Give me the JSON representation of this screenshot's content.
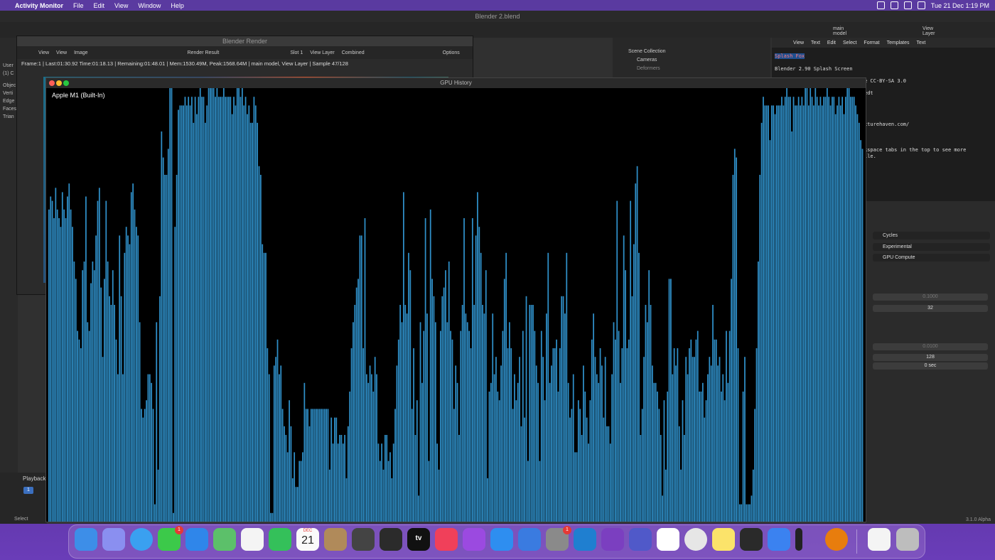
{
  "menubar": {
    "app_name": "Activity Monitor",
    "menus": [
      "File",
      "Edit",
      "View",
      "Window",
      "Help"
    ],
    "clock": "Tue 21 Dec  1:19 PM"
  },
  "blender": {
    "window_title": "Blender 2.blend",
    "left_info": [
      "User",
      "(1) C",
      "Objec",
      "Verti",
      "Edge",
      "Faces",
      "Trian"
    ],
    "playback_label": "Playback",
    "current_frame": "1",
    "select_label": "Select",
    "version": "3.1.0 Alpha",
    "outliner": {
      "search_value": "main model",
      "view_layer": "View Layer",
      "rows": [
        "Scene Collection",
        "Cameras",
        "Deformers"
      ]
    },
    "text_editor": {
      "menus": [
        "View",
        "Text",
        "Edit",
        "Select",
        "Format",
        "Templates"
      ],
      "file_name": "Text",
      "lines": [
        "Splash Fox",
        "Blender 2.90 Splash Screen",
        "e CC-BY-SA 3.0",
        "edt",
        "xturehaven.com/",
        "kspace tabs in the top to see more",
        "ile."
      ]
    },
    "properties": {
      "render_engine": "Cycles",
      "feature_set": "Experimental",
      "device": "GPU Compute",
      "noise_threshold_viewport": "0.1000",
      "max_samples_viewport": "32",
      "noise_threshold_render": "0.0100",
      "max_samples_render": "128",
      "time_limit": "0 sec"
    }
  },
  "render_window": {
    "title": "Blender Render",
    "toolbar": [
      "View",
      "View",
      "Image",
      "Render Result",
      "Slot 1",
      "View Layer",
      "Combined"
    ],
    "options_label": "Options",
    "status": "Frame:1 | Last:01:30.92 Time:01:18.13 | Remaining:01:48.01 | Mem:1530.49M, Peak:1568.64M | main model, View Layer | Sample 47/128"
  },
  "gpu_window": {
    "title": "GPU History",
    "gpu_name": "Apple M1 (Built-In)",
    "bar_color": "#2f8fc8"
  },
  "chart_data": {
    "type": "bar",
    "title": "",
    "xlabel": "",
    "ylabel": "",
    "ylim": [
      0,
      100
    ],
    "series": [
      {
        "values": [
          72,
          75,
          74,
          70,
          77,
          72,
          70,
          68,
          76,
          72,
          70,
          75,
          78,
          72,
          68,
          60,
          56,
          44,
          42,
          40,
          58,
          60,
          75,
          46,
          44,
          55,
          60,
          58,
          66,
          74,
          77,
          54,
          38,
          56,
          74,
          60,
          52,
          50,
          58,
          50,
          42,
          34,
          66,
          52,
          34,
          62,
          68,
          66,
          64,
          76,
          78,
          72,
          68,
          66,
          46,
          26,
          24,
          26,
          28,
          34,
          34,
          32,
          26,
          4,
          46,
          12,
          52,
          90,
          84,
          80,
          80,
          86,
          100,
          100,
          2,
          68,
          80,
          95,
          96,
          96,
          96,
          98,
          96,
          98,
          96,
          98,
          92,
          98,
          94,
          98,
          100,
          98,
          98,
          92,
          96,
          100,
          100,
          100,
          100,
          98,
          100,
          98,
          98,
          98,
          100,
          98,
          98,
          98,
          98,
          94,
          98,
          96,
          100,
          100,
          98,
          100,
          96,
          98,
          94,
          96,
          92,
          92,
          98,
          96,
          92,
          82,
          80,
          64,
          62,
          62,
          40,
          34,
          2,
          2,
          36,
          38,
          42,
          34,
          36,
          26,
          22,
          20,
          16,
          28,
          22,
          10,
          16,
          8,
          8,
          14,
          14,
          16,
          32,
          26,
          26,
          22,
          26,
          26,
          26,
          26,
          26,
          26,
          26,
          26,
          26,
          26,
          26,
          12,
          24,
          18,
          24,
          24,
          18,
          20,
          20,
          18,
          20,
          10,
          22,
          30,
          40,
          46,
          50,
          54,
          56,
          66,
          66,
          40,
          70,
          34,
          32,
          36,
          34,
          30,
          38,
          34,
          18,
          14,
          18,
          12,
          20,
          20,
          14,
          16,
          10,
          18,
          26,
          36,
          42,
          50,
          46,
          76,
          50,
          48,
          62,
          58,
          26,
          40,
          20,
          28,
          6,
          46,
          32,
          44,
          70,
          48,
          14,
          72,
          56,
          52,
          46,
          18,
          12,
          44,
          52,
          54,
          58,
          46,
          60,
          44,
          42,
          26,
          36,
          32,
          20,
          44,
          50,
          70,
          48,
          46,
          44,
          40,
          70,
          50,
          66,
          76,
          68,
          62,
          50,
          48,
          58,
          10,
          30,
          32,
          48,
          34,
          38,
          30,
          28,
          36,
          44,
          56,
          62,
          40,
          46,
          40,
          26,
          34,
          28,
          32,
          38,
          22,
          44,
          24,
          52,
          14,
          50,
          50,
          50,
          44,
          36,
          32,
          14,
          44,
          38,
          28,
          48,
          62,
          32,
          36,
          40,
          40,
          42,
          30,
          40,
          52,
          52,
          48,
          62,
          32,
          24,
          26,
          34,
          16,
          16,
          28,
          26,
          20,
          36,
          30,
          24,
          18,
          28,
          42,
          48,
          38,
          34,
          32,
          40,
          36,
          24,
          38,
          22,
          22,
          18,
          34,
          46,
          42,
          74,
          44,
          32,
          40,
          66,
          58,
          40,
          42,
          74,
          52,
          64,
          78,
          82,
          62,
          20,
          26,
          38,
          50,
          46,
          58,
          50,
          36,
          32,
          32,
          30,
          26,
          20,
          6,
          28,
          12,
          30,
          56,
          56,
          34,
          40,
          36,
          40,
          22,
          12,
          28,
          20,
          38,
          34,
          40,
          42,
          38,
          38,
          42,
          44,
          30,
          30,
          32,
          24,
          28,
          34,
          38,
          36,
          50,
          42,
          42,
          36,
          38,
          30,
          34,
          28,
          44,
          32,
          44,
          56,
          80,
          86,
          84,
          40,
          4,
          4,
          30,
          38,
          4,
          4,
          4,
          6,
          12,
          26,
          40,
          60,
          80,
          92,
          98,
          96,
          96,
          96,
          88,
          96,
          96,
          94,
          96,
          96,
          96,
          98,
          96,
          98,
          100,
          98,
          98,
          90,
          98,
          96,
          96,
          98,
          96,
          98,
          96,
          100,
          100,
          96,
          100,
          98,
          96,
          100,
          98,
          96,
          98,
          96,
          98,
          98,
          100,
          98,
          96,
          98,
          98,
          94,
          96,
          98,
          96,
          98,
          94,
          98,
          100,
          100,
          98,
          98,
          98,
          96,
          94,
          92,
          88,
          86
        ]
      }
    ]
  },
  "dock": {
    "calendar_month": "DEC",
    "calendar_day": "21",
    "messages_badge": "1",
    "settings_badge": "1",
    "tv_label": "tv"
  }
}
